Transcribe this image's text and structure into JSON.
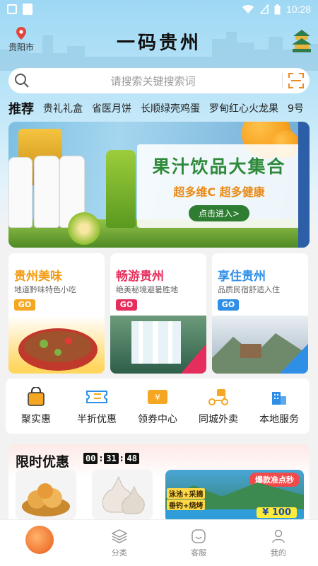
{
  "status_bar": {
    "time": "10:28"
  },
  "header": {
    "location": "贵阳市",
    "app_title": "一码贵州"
  },
  "search": {
    "placeholder": "请搜索关键搜索词"
  },
  "categories": [
    {
      "label": "推荐",
      "active": true
    },
    {
      "label": "贵礼礼盒"
    },
    {
      "label": "省医月饼"
    },
    {
      "label": "长顺绿壳鸡蛋"
    },
    {
      "label": "罗甸红心火龙果"
    },
    {
      "label": "9号"
    }
  ],
  "banner": {
    "headline": "果汁饮品大集合",
    "subline": "超多维C 超多健康",
    "button": "点击进入>"
  },
  "promo_cards": [
    {
      "title": "贵州美味",
      "subtitle": "地道黔味特色小吃",
      "go": "GO",
      "color": "#f39c12",
      "go_color": "#f5a623"
    },
    {
      "title": "畅游贵州",
      "subtitle": "绝美秘境避暑胜地",
      "go": "GO",
      "color": "#e62e5c",
      "go_color": "#e62e5c"
    },
    {
      "title": "享住贵州",
      "subtitle": "品质民宿舒适入住",
      "go": "GO",
      "color": "#2f8fe6",
      "go_color": "#2f8fe6"
    }
  ],
  "services": [
    {
      "label": "聚实惠",
      "icon": "shopping-bag-icon"
    },
    {
      "label": "半折优惠",
      "icon": "ticket-icon"
    },
    {
      "label": "领券中心",
      "icon": "coupon-icon"
    },
    {
      "label": "同城外卖",
      "icon": "delivery-scooter-icon"
    },
    {
      "label": "本地服务",
      "icon": "building-icon"
    }
  ],
  "flash_sale": {
    "title": "限时优惠",
    "countdown": {
      "h": "00",
      "m": "31",
      "s": "48"
    },
    "banner_badge": "爆款准点秒",
    "banner_tags": [
      "泳池+采摘",
      "垂钓+烧烤"
    ],
    "banner_price": "¥ 100"
  },
  "tab_bar": [
    {
      "label": "",
      "icon": "home-logo-icon"
    },
    {
      "label": "分类",
      "icon": "layers-icon"
    },
    {
      "label": "客服",
      "icon": "chat-icon"
    },
    {
      "label": "我的",
      "icon": "user-icon"
    }
  ]
}
